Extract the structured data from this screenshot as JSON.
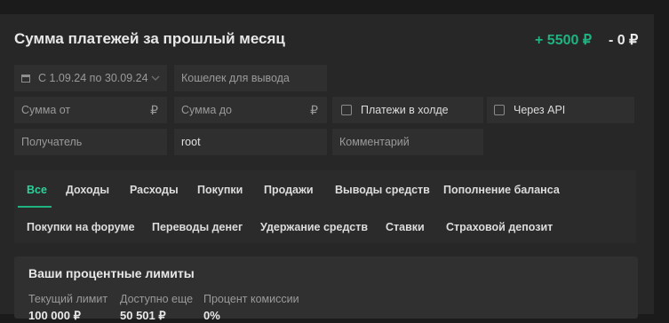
{
  "header": {
    "title": "Сумма платежей за прошлый месяц",
    "income": "+ 5500 ₽",
    "expense": "- 0 ₽"
  },
  "filters": {
    "date_range": "С 1.09.24 по 30.09.24",
    "wallet_placeholder": "Кошелек для вывода",
    "amount_from_placeholder": "Сумма от",
    "amount_to_placeholder": "Сумма до",
    "currency_symbol": "₽",
    "hold_label": "Платежи в холде",
    "api_label": "Через API",
    "recipient_placeholder": "Получатель",
    "sender_value": "root",
    "comment_placeholder": "Комментарий"
  },
  "tabs": {
    "row1": [
      "Все",
      "Доходы",
      "Расходы",
      "Покупки",
      "Продажи",
      "Выводы средств",
      "Пополнение баланса"
    ],
    "row2": [
      "Покупки на форуме",
      "Переводы денег",
      "Удержание средств",
      "Ставки",
      "Страховой депозит"
    ],
    "active": "Все"
  },
  "limits": {
    "title": "Ваши процентные лимиты",
    "headers": [
      "Текущий лимит",
      "Доступно еще",
      "Процент комиссии"
    ],
    "values": [
      "100 000 ₽",
      "50 501 ₽",
      "0%"
    ]
  },
  "colors": {
    "accent": "#1fb380",
    "background": "#1b1b1b",
    "panel": "#272727"
  }
}
